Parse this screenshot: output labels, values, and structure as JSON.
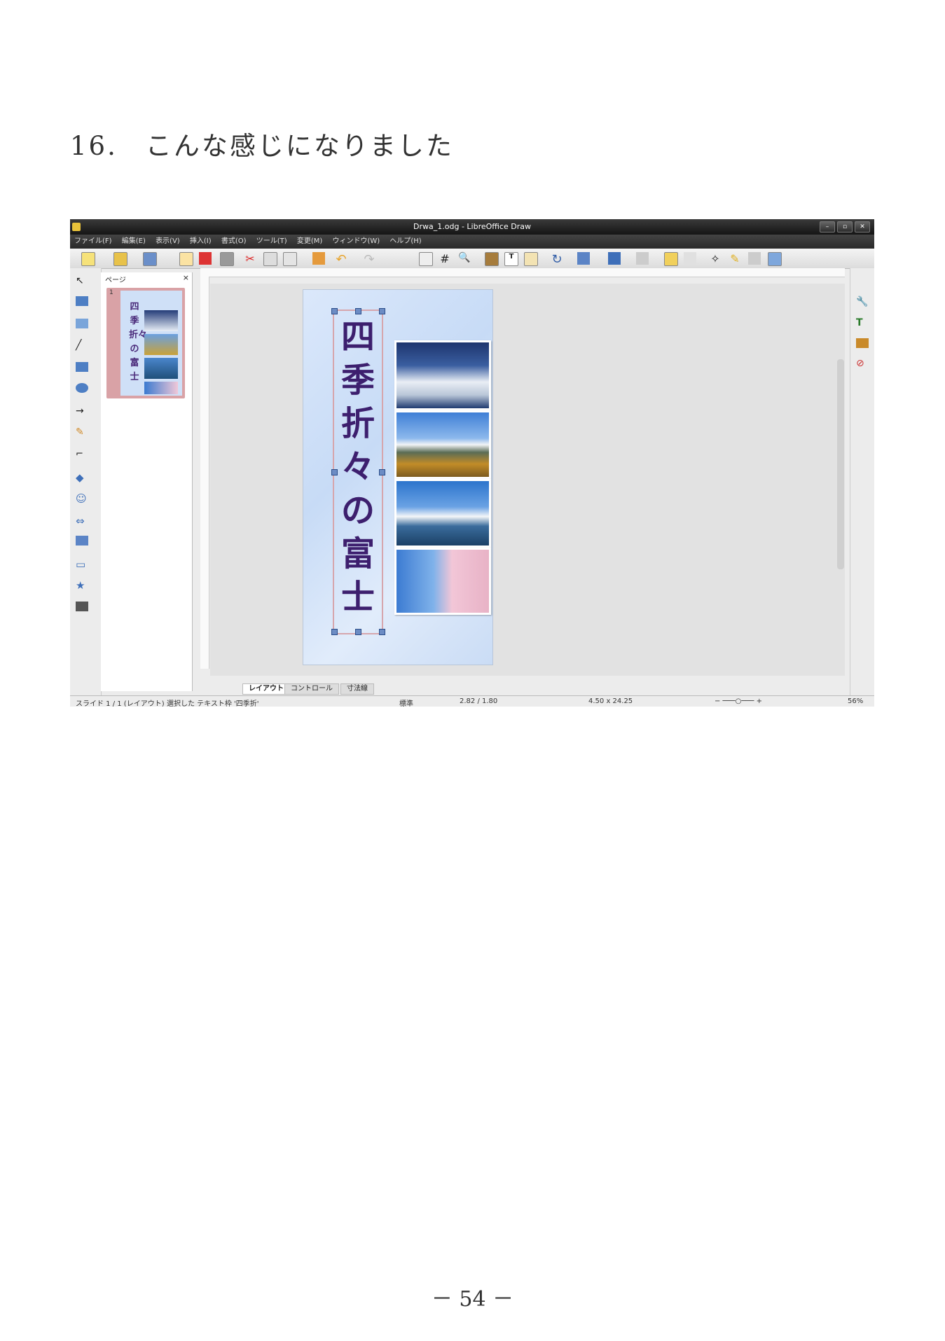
{
  "heading": "16.　こんな感じになりました",
  "page_number": "－ 54 －",
  "window": {
    "title": "Drwa_1.odg - LibreOffice Draw",
    "menu": [
      "ファイル(F)",
      "編集(E)",
      "表示(V)",
      "挿入(I)",
      "書式(O)",
      "ツール(T)",
      "変更(M)",
      "ウィンドウ(W)",
      "ヘルプ(H)"
    ]
  },
  "pages_pane": {
    "header": "ページ",
    "close": "×",
    "thumb_number": "1"
  },
  "document": {
    "vertical_text": "四季折々の富士"
  },
  "tabs": [
    "レイアウト",
    "コントロール",
    "寸法線"
  ],
  "status": {
    "slide": "スライド 1 / 1 (レイアウト)",
    "selection": "選択した テキスト枠 '四季折'",
    "style": "標準",
    "position": "2.82 / 1.80",
    "size": "4.50 x 24.25",
    "zoom": "56%"
  },
  "colors": {
    "title_text": "#3d1f6e",
    "page_bg": "#cfe0f7",
    "thumb_frame": "#d9a2a6"
  }
}
